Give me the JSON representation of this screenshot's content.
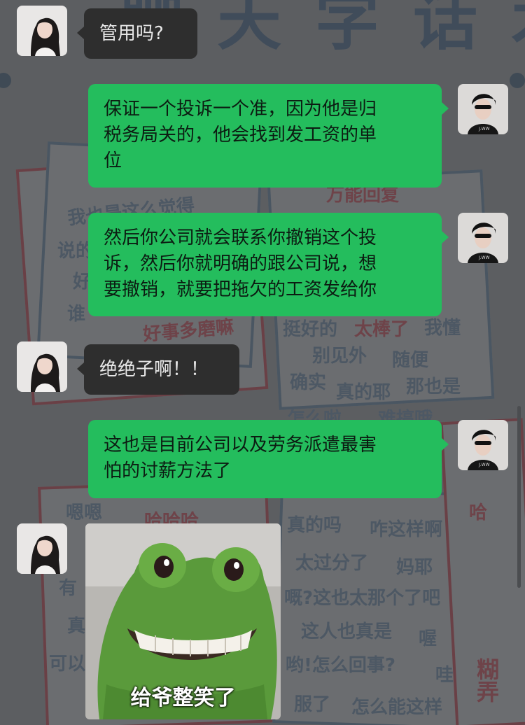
{
  "wallpaper": {
    "header_text": "聊 天 字 话 术",
    "words": [
      "我也是这么觉得",
      "好事多磨嘛",
      "万能回复",
      "别见外",
      "随便",
      "确实",
      "真的耶",
      "那也是",
      "怎么啦",
      "难搞哦",
      "我懂",
      "嗯嗯",
      "哈哈哈",
      "真的吗",
      "咋这样啊",
      "太过分了",
      "妈耶",
      "嘅?这也太那个了吧",
      "这人也真是",
      "喔",
      "哟!怎么回事?",
      "哇",
      "服了",
      "怎么能这样",
      "哈",
      "糊弄",
      "说的",
      "好",
      "谁",
      "有",
      "真",
      "可以",
      "太棒了",
      "挺好的"
    ]
  },
  "messages": [
    {
      "side": "left",
      "avatar": "female-avatar",
      "lines": [
        "管用吗?"
      ]
    },
    {
      "side": "right",
      "avatar": "male-avatar",
      "lines": [
        "保证一个投诉一个准，因为他是归",
        "税务局关的，他会找到发工资的单",
        "位"
      ]
    },
    {
      "side": "right",
      "avatar": "male-avatar",
      "lines": [
        "然后你公司就会联系你撤销这个投",
        "诉，然后你就明确的跟公司说，想",
        "要撤销，就要把拖欠的工资发给你"
      ]
    },
    {
      "side": "left",
      "avatar": "female-avatar",
      "lines": [
        "绝绝子啊！！"
      ]
    },
    {
      "side": "right",
      "avatar": "male-avatar",
      "lines": [
        "这也是目前公司以及劳务派遣最害",
        "怕的讨薪方法了"
      ]
    }
  ],
  "sticker": {
    "caption": "给爷整笑了",
    "icon": "frog-plush-sticker"
  },
  "colors": {
    "bubble_right": "#24bd5d",
    "bubble_left": "#2e2e2e",
    "background": "#5c5e61"
  }
}
